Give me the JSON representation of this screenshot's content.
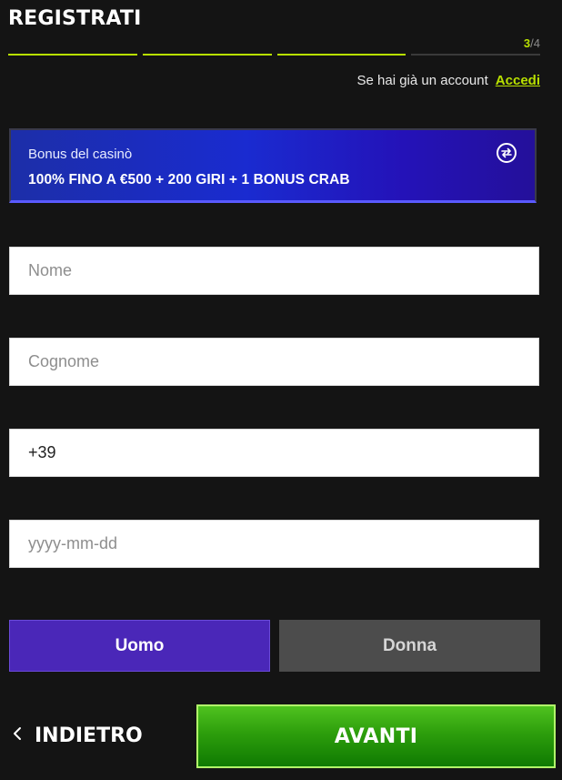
{
  "header": {
    "title": "REGISTRATI",
    "step_current": "3",
    "step_separator": "/",
    "step_total": "4",
    "progress": {
      "completed_steps": 3,
      "total_steps": 4
    },
    "login_question": "Se hai già un account",
    "login_link": "Accedi"
  },
  "bonus": {
    "label": "Bonus del casinò",
    "headline": "100% FINO A €500 + 200 GIRI + 1 BONUS CRAB",
    "icon": "swap-circle-icon"
  },
  "form": {
    "first_name": {
      "placeholder": "Nome",
      "value": ""
    },
    "last_name": {
      "placeholder": "Cognome",
      "value": ""
    },
    "phone": {
      "placeholder": "",
      "value": "+39"
    },
    "birthdate": {
      "placeholder": "yyyy-mm-dd",
      "value": ""
    }
  },
  "gender": {
    "male_label": "Uomo",
    "female_label": "Donna",
    "selected": "Uomo"
  },
  "footer": {
    "back_icon": "chevron-left-icon",
    "back_label": "INDIETRO",
    "next_label": "AVANTI"
  },
  "colors": {
    "background": "#141414",
    "accent": "#b8e000",
    "selected_gender": "#4a27b8",
    "next_button": "#2d9e0c"
  }
}
